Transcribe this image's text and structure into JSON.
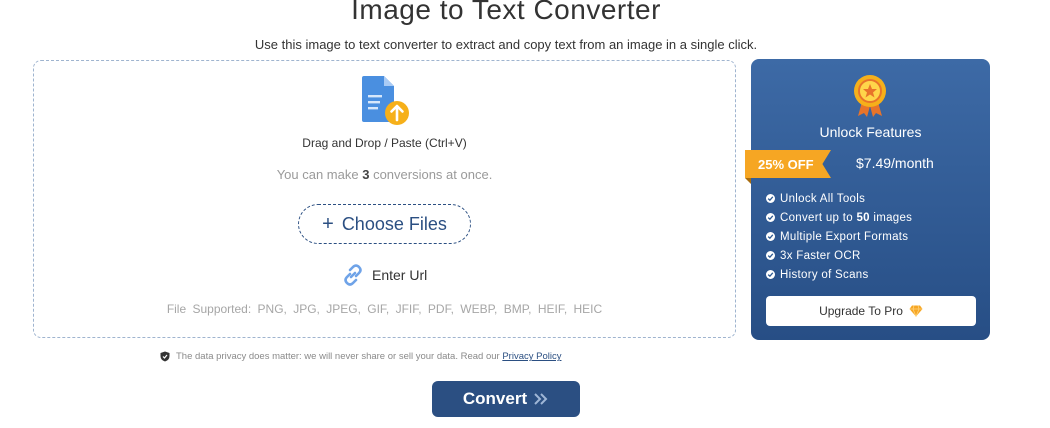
{
  "header": {
    "title": "Image to Text Converter",
    "subtitle": "Use this image to text converter to extract and copy text from an image in a single click."
  },
  "upload": {
    "drag_text": "Drag and Drop / Paste (Ctrl+V)",
    "conversions_prefix": "You can make ",
    "conversions_count": "3",
    "conversions_suffix": " conversions at once.",
    "choose_files_label": "Choose Files",
    "enter_url_label": "Enter Url",
    "supported_label": "File Supported:",
    "formats": "PNG, JPG, JPEG, GIF, JFIF, PDF, WEBP, BMP, HEIF, HEIC"
  },
  "privacy": {
    "text": "The data privacy does matter: we will never share or sell your data. Read our ",
    "link": "Privacy Policy"
  },
  "convert": {
    "label": "Convert"
  },
  "pro": {
    "title": "Unlock Features",
    "discount": "25% OFF",
    "price": "$7.49/month",
    "features": [
      {
        "before": "Unlock All Tools",
        "bold": "",
        "after": ""
      },
      {
        "before": "Convert up to ",
        "bold": "50",
        "after": " images"
      },
      {
        "before": "Multiple Export Formats",
        "bold": "",
        "after": ""
      },
      {
        "before": "3x Faster OCR",
        "bold": "",
        "after": ""
      },
      {
        "before": "History of Scans",
        "bold": "",
        "after": ""
      }
    ],
    "upgrade_label": "Upgrade To Pro"
  },
  "colors": {
    "brand": "#2b4f82",
    "panel_top": "#3d6aa6",
    "accent_orange": "#f6a623",
    "file_icon_blue": "#4a8fe0"
  },
  "icons": {
    "file": "file-upload-icon",
    "link": "link-icon",
    "shield": "shield-icon",
    "medal": "medal-icon",
    "check": "check-icon",
    "diamond": "diamond-icon",
    "chevrons": "double-chevron-right-icon"
  }
}
